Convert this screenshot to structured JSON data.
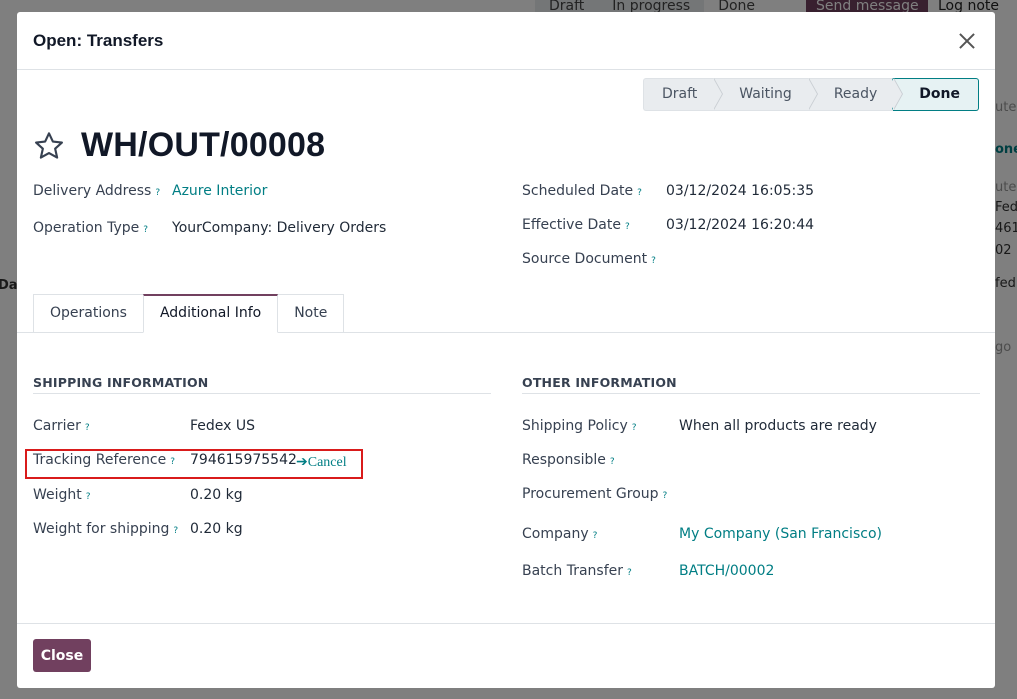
{
  "background": {
    "statusbar": [
      "Draft",
      "In progress",
      "Done"
    ],
    "send_message": "Send message",
    "log_note": "Log note",
    "right_snippets": [
      "ute",
      "one",
      "ute",
      "Fed",
      "461",
      "02",
      "fed",
      "go"
    ],
    "left_snippet": "Dat"
  },
  "modal": {
    "title": "Open: Transfers",
    "stages": [
      "Draft",
      "Waiting",
      "Ready",
      "Done"
    ],
    "record_name": "WH/OUT/00008",
    "fields_left": [
      {
        "label": "Delivery Address",
        "value": "Azure Interior"
      },
      {
        "label": "Operation Type",
        "value": "YourCompany: Delivery Orders"
      }
    ],
    "fields_right": [
      {
        "label": "Scheduled Date",
        "value": "03/12/2024 16:05:35"
      },
      {
        "label": "Effective Date",
        "value": "03/12/2024 16:20:44"
      },
      {
        "label": "Source Document",
        "value": ""
      }
    ],
    "tabs": [
      "Operations",
      "Additional Info",
      "Note"
    ],
    "shipping": {
      "title": "SHIPPING INFORMATION",
      "carrier_label": "Carrier",
      "carrier": "Fedex US",
      "tracking_label": "Tracking Reference",
      "tracking": "794615975542",
      "cancel": "Cancel",
      "weight_label": "Weight",
      "weight": "0.20",
      "weight_shipping_label": "Weight for shipping",
      "weight_shipping": "0.20",
      "unit": "kg"
    },
    "other": {
      "title": "OTHER INFORMATION",
      "shipping_policy_label": "Shipping Policy",
      "shipping_policy": "When all products are ready",
      "responsible_label": "Responsible",
      "procurement_label": "Procurement Group",
      "company_label": "Company",
      "company": "My Company (San Francisco)",
      "batch_label": "Batch Transfer",
      "batch": "BATCH/00002"
    },
    "close_button": "Close",
    "help_mark": "?"
  },
  "colors": {
    "accent": "#017e84",
    "primary": "#71405f",
    "highlight": "#d91b1b"
  }
}
